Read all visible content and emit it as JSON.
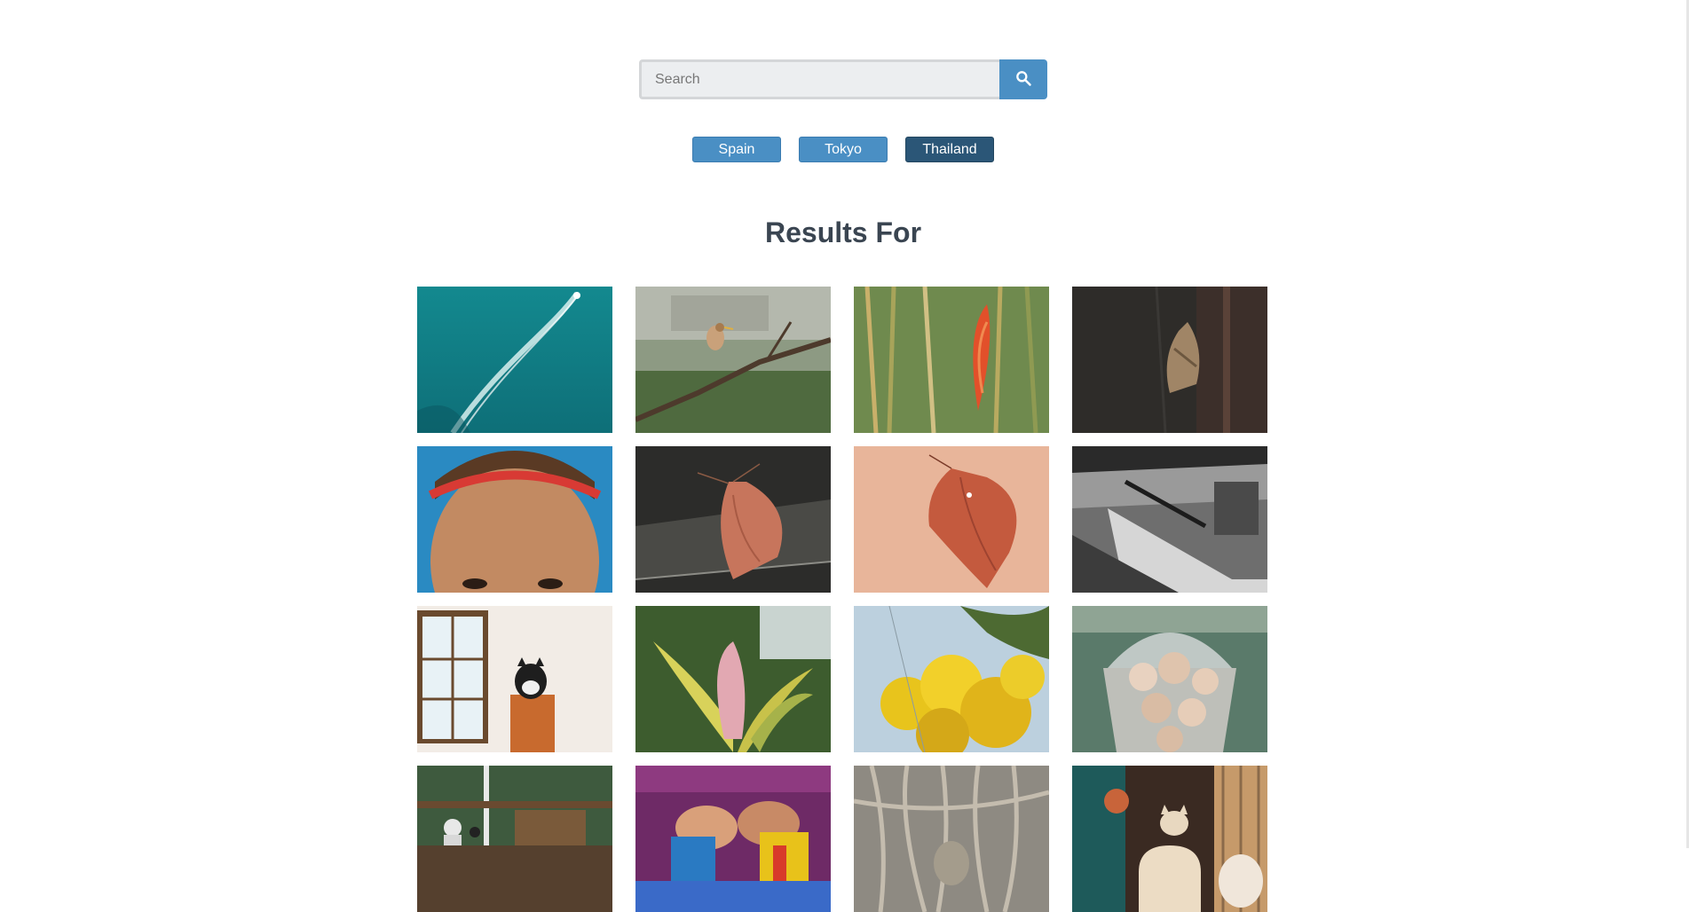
{
  "search": {
    "placeholder": "Search",
    "value": ""
  },
  "tags": [
    {
      "label": "Spain",
      "active": false
    },
    {
      "label": "Tokyo",
      "active": false
    },
    {
      "label": "Thailand",
      "active": true
    }
  ],
  "results_heading": "Results For",
  "colors": {
    "accent": "#4a8fc4",
    "active_tag": "#2b5677",
    "heading": "#3a4551"
  },
  "photos": [
    {
      "subject": "boat-wake-on-turquoise-sea"
    },
    {
      "subject": "heron-on-branch"
    },
    {
      "subject": "red-flower-among-bamboo"
    },
    {
      "subject": "moth-on-dark-wood"
    },
    {
      "subject": "woman-with-red-headband"
    },
    {
      "subject": "orange-moth-on-stone"
    },
    {
      "subject": "orange-moth-on-sand"
    },
    {
      "subject": "mall-escalators-black-and-white"
    },
    {
      "subject": "cat-on-wooden-box-by-window"
    },
    {
      "subject": "tropical-flower-bud"
    },
    {
      "subject": "yellow-flowers-against-sky"
    },
    {
      "subject": "snack-in-plastic-cup"
    },
    {
      "subject": "cafe-interior"
    },
    {
      "subject": "wrestling-match"
    },
    {
      "subject": "tree-roots"
    },
    {
      "subject": "cafe-shelf-with-figurines"
    }
  ]
}
